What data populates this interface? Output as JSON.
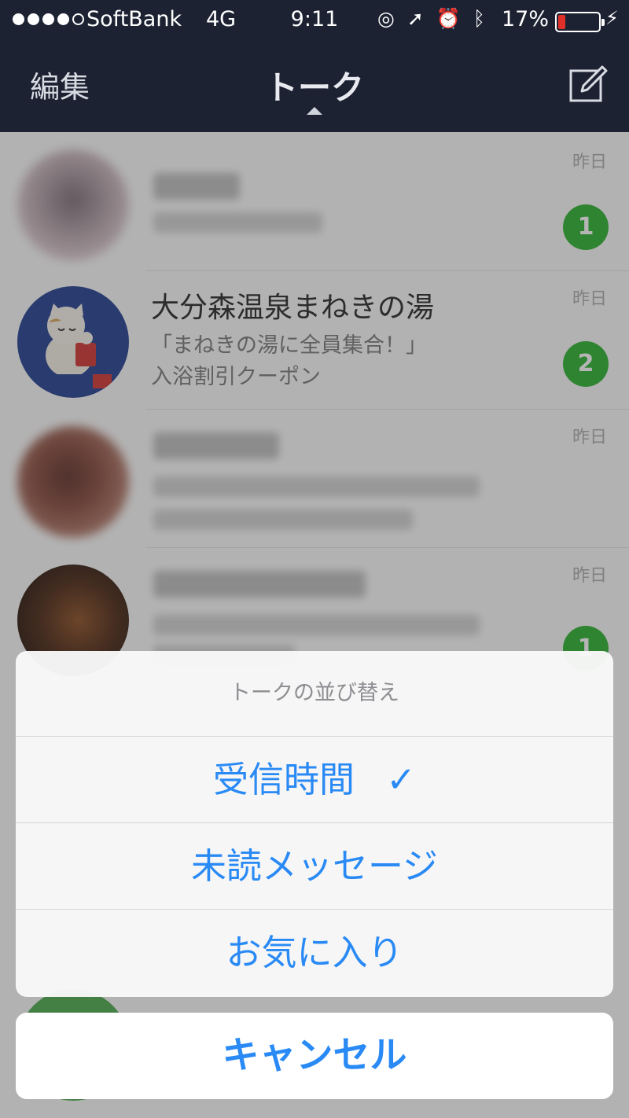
{
  "status": {
    "carrier": "SoftBank",
    "network": "4G",
    "time": "9:11",
    "battery_percent": "17%",
    "battery_level": 0.17
  },
  "nav": {
    "edit": "編集",
    "title": "トーク"
  },
  "chats": [
    {
      "name": "",
      "message_lines": [],
      "time": "昨日",
      "badge": "1"
    },
    {
      "name": "大分森温泉まねきの湯",
      "message_lines": [
        "「まねきの湯に全員集合！」",
        "入浴割引クーポン"
      ],
      "time": "昨日",
      "badge": "2"
    },
    {
      "name": "",
      "message_lines": [],
      "time": "昨日",
      "badge": ""
    },
    {
      "name": "",
      "message_lines": [],
      "time": "昨日",
      "badge": "1"
    }
  ],
  "sheet": {
    "title": "トークの並び替え",
    "options": [
      {
        "label": "受信時間",
        "check": "✓",
        "selected": true
      },
      {
        "label": "未読メッセージ",
        "selected": false
      },
      {
        "label": "お気に入り",
        "selected": false
      }
    ],
    "cancel": "キャンセル"
  },
  "colors": {
    "navbar": "#1c2232",
    "accent": "#2a8af5",
    "badge": "#28b02a"
  }
}
